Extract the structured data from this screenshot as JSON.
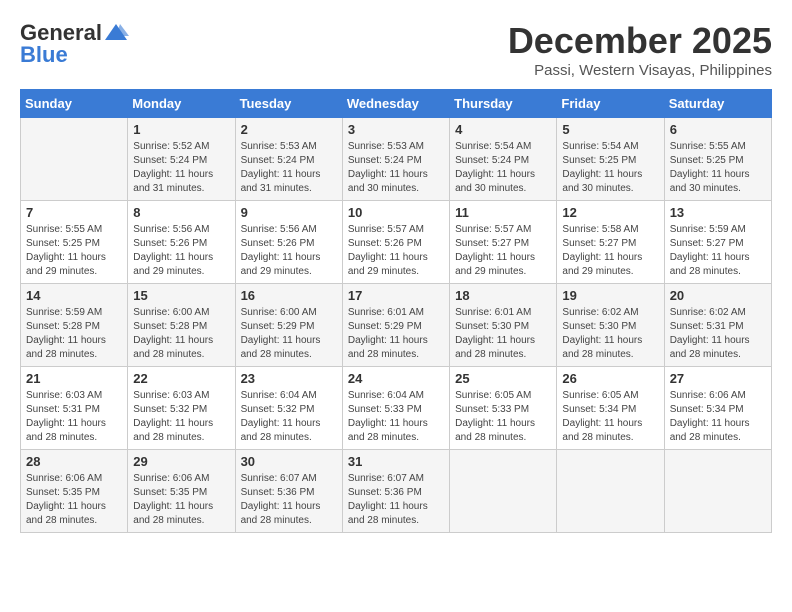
{
  "logo": {
    "general": "General",
    "blue": "Blue"
  },
  "title": "December 2025",
  "location": "Passi, Western Visayas, Philippines",
  "headers": [
    "Sunday",
    "Monday",
    "Tuesday",
    "Wednesday",
    "Thursday",
    "Friday",
    "Saturday"
  ],
  "weeks": [
    [
      {
        "day": "",
        "sunrise": "",
        "sunset": "",
        "daylight": ""
      },
      {
        "day": "1",
        "sunrise": "Sunrise: 5:52 AM",
        "sunset": "Sunset: 5:24 PM",
        "daylight": "Daylight: 11 hours and 31 minutes."
      },
      {
        "day": "2",
        "sunrise": "Sunrise: 5:53 AM",
        "sunset": "Sunset: 5:24 PM",
        "daylight": "Daylight: 11 hours and 31 minutes."
      },
      {
        "day": "3",
        "sunrise": "Sunrise: 5:53 AM",
        "sunset": "Sunset: 5:24 PM",
        "daylight": "Daylight: 11 hours and 30 minutes."
      },
      {
        "day": "4",
        "sunrise": "Sunrise: 5:54 AM",
        "sunset": "Sunset: 5:24 PM",
        "daylight": "Daylight: 11 hours and 30 minutes."
      },
      {
        "day": "5",
        "sunrise": "Sunrise: 5:54 AM",
        "sunset": "Sunset: 5:25 PM",
        "daylight": "Daylight: 11 hours and 30 minutes."
      },
      {
        "day": "6",
        "sunrise": "Sunrise: 5:55 AM",
        "sunset": "Sunset: 5:25 PM",
        "daylight": "Daylight: 11 hours and 30 minutes."
      }
    ],
    [
      {
        "day": "7",
        "sunrise": "Sunrise: 5:55 AM",
        "sunset": "Sunset: 5:25 PM",
        "daylight": "Daylight: 11 hours and 29 minutes."
      },
      {
        "day": "8",
        "sunrise": "Sunrise: 5:56 AM",
        "sunset": "Sunset: 5:26 PM",
        "daylight": "Daylight: 11 hours and 29 minutes."
      },
      {
        "day": "9",
        "sunrise": "Sunrise: 5:56 AM",
        "sunset": "Sunset: 5:26 PM",
        "daylight": "Daylight: 11 hours and 29 minutes."
      },
      {
        "day": "10",
        "sunrise": "Sunrise: 5:57 AM",
        "sunset": "Sunset: 5:26 PM",
        "daylight": "Daylight: 11 hours and 29 minutes."
      },
      {
        "day": "11",
        "sunrise": "Sunrise: 5:57 AM",
        "sunset": "Sunset: 5:27 PM",
        "daylight": "Daylight: 11 hours and 29 minutes."
      },
      {
        "day": "12",
        "sunrise": "Sunrise: 5:58 AM",
        "sunset": "Sunset: 5:27 PM",
        "daylight": "Daylight: 11 hours and 29 minutes."
      },
      {
        "day": "13",
        "sunrise": "Sunrise: 5:59 AM",
        "sunset": "Sunset: 5:27 PM",
        "daylight": "Daylight: 11 hours and 28 minutes."
      }
    ],
    [
      {
        "day": "14",
        "sunrise": "Sunrise: 5:59 AM",
        "sunset": "Sunset: 5:28 PM",
        "daylight": "Daylight: 11 hours and 28 minutes."
      },
      {
        "day": "15",
        "sunrise": "Sunrise: 6:00 AM",
        "sunset": "Sunset: 5:28 PM",
        "daylight": "Daylight: 11 hours and 28 minutes."
      },
      {
        "day": "16",
        "sunrise": "Sunrise: 6:00 AM",
        "sunset": "Sunset: 5:29 PM",
        "daylight": "Daylight: 11 hours and 28 minutes."
      },
      {
        "day": "17",
        "sunrise": "Sunrise: 6:01 AM",
        "sunset": "Sunset: 5:29 PM",
        "daylight": "Daylight: 11 hours and 28 minutes."
      },
      {
        "day": "18",
        "sunrise": "Sunrise: 6:01 AM",
        "sunset": "Sunset: 5:30 PM",
        "daylight": "Daylight: 11 hours and 28 minutes."
      },
      {
        "day": "19",
        "sunrise": "Sunrise: 6:02 AM",
        "sunset": "Sunset: 5:30 PM",
        "daylight": "Daylight: 11 hours and 28 minutes."
      },
      {
        "day": "20",
        "sunrise": "Sunrise: 6:02 AM",
        "sunset": "Sunset: 5:31 PM",
        "daylight": "Daylight: 11 hours and 28 minutes."
      }
    ],
    [
      {
        "day": "21",
        "sunrise": "Sunrise: 6:03 AM",
        "sunset": "Sunset: 5:31 PM",
        "daylight": "Daylight: 11 hours and 28 minutes."
      },
      {
        "day": "22",
        "sunrise": "Sunrise: 6:03 AM",
        "sunset": "Sunset: 5:32 PM",
        "daylight": "Daylight: 11 hours and 28 minutes."
      },
      {
        "day": "23",
        "sunrise": "Sunrise: 6:04 AM",
        "sunset": "Sunset: 5:32 PM",
        "daylight": "Daylight: 11 hours and 28 minutes."
      },
      {
        "day": "24",
        "sunrise": "Sunrise: 6:04 AM",
        "sunset": "Sunset: 5:33 PM",
        "daylight": "Daylight: 11 hours and 28 minutes."
      },
      {
        "day": "25",
        "sunrise": "Sunrise: 6:05 AM",
        "sunset": "Sunset: 5:33 PM",
        "daylight": "Daylight: 11 hours and 28 minutes."
      },
      {
        "day": "26",
        "sunrise": "Sunrise: 6:05 AM",
        "sunset": "Sunset: 5:34 PM",
        "daylight": "Daylight: 11 hours and 28 minutes."
      },
      {
        "day": "27",
        "sunrise": "Sunrise: 6:06 AM",
        "sunset": "Sunset: 5:34 PM",
        "daylight": "Daylight: 11 hours and 28 minutes."
      }
    ],
    [
      {
        "day": "28",
        "sunrise": "Sunrise: 6:06 AM",
        "sunset": "Sunset: 5:35 PM",
        "daylight": "Daylight: 11 hours and 28 minutes."
      },
      {
        "day": "29",
        "sunrise": "Sunrise: 6:06 AM",
        "sunset": "Sunset: 5:35 PM",
        "daylight": "Daylight: 11 hours and 28 minutes."
      },
      {
        "day": "30",
        "sunrise": "Sunrise: 6:07 AM",
        "sunset": "Sunset: 5:36 PM",
        "daylight": "Daylight: 11 hours and 28 minutes."
      },
      {
        "day": "31",
        "sunrise": "Sunrise: 6:07 AM",
        "sunset": "Sunset: 5:36 PM",
        "daylight": "Daylight: 11 hours and 28 minutes."
      },
      {
        "day": "",
        "sunrise": "",
        "sunset": "",
        "daylight": ""
      },
      {
        "day": "",
        "sunrise": "",
        "sunset": "",
        "daylight": ""
      },
      {
        "day": "",
        "sunrise": "",
        "sunset": "",
        "daylight": ""
      }
    ]
  ]
}
